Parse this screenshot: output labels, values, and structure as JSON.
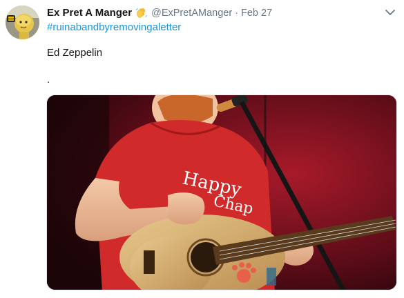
{
  "tweet": {
    "display_name": "Ex Pret A Manger",
    "name_emoji_icon": "waving-hand-icon",
    "handle": "@ExPretAManger",
    "separator": "·",
    "date": "Feb 27",
    "hashtag": "#ruinabandbyremovingaletter",
    "text": "Ed Zeppelin",
    "text_extra": ".",
    "caret_icon": "chevron-down-icon",
    "media_description_icon": "photo-guitarist"
  },
  "colors": {
    "link": "#1b95e0",
    "secondary_text": "#657786",
    "primary_text": "#14171a"
  }
}
